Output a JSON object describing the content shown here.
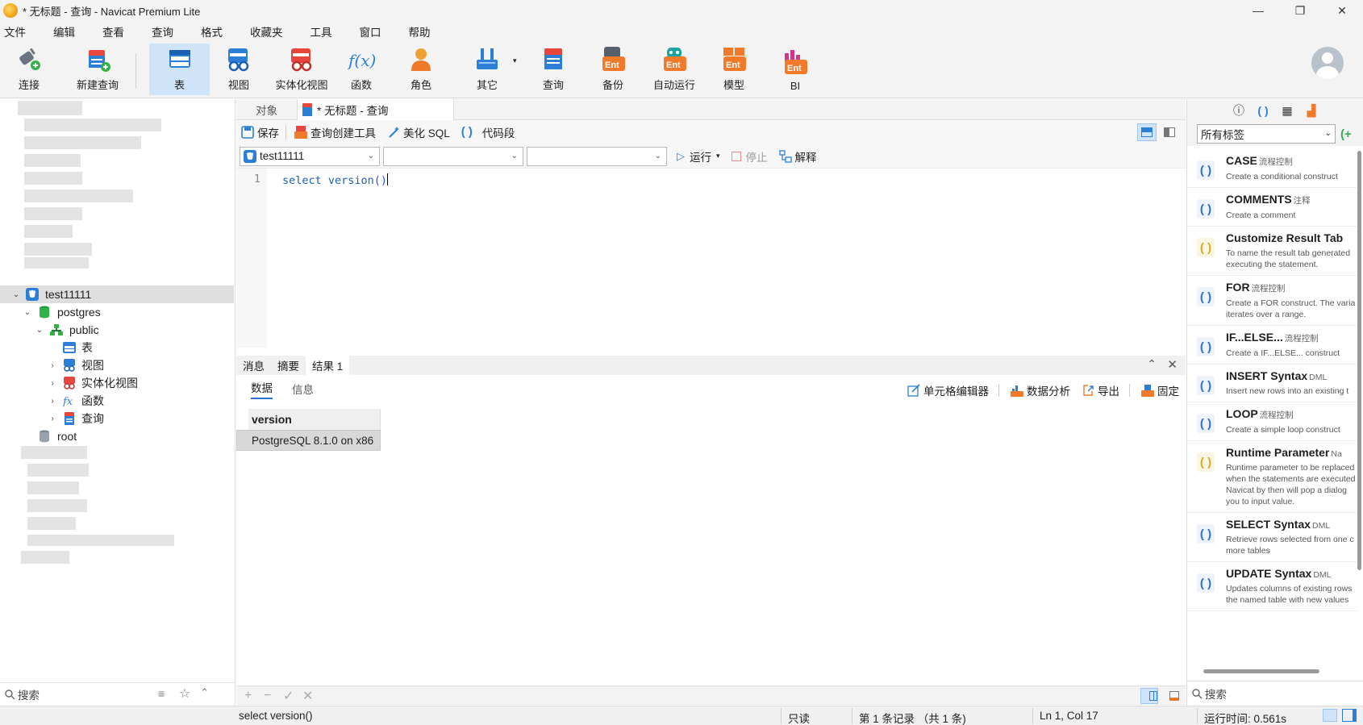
{
  "window": {
    "title": "* 无标题 - 查询 - Navicat Premium Lite",
    "controls": [
      "—",
      "❐",
      "✕"
    ]
  },
  "menu": [
    "文件",
    "编辑",
    "查看",
    "查询",
    "格式",
    "收藏夹",
    "工具",
    "窗口",
    "帮助"
  ],
  "toolbar": {
    "connect": "连接",
    "new_query": "新建查询",
    "table": "表",
    "view": "视图",
    "materialized_view": "实体化视图",
    "function": "函数",
    "role": "角色",
    "other": "其它",
    "query": "查询",
    "backup": "备份",
    "automation": "自动运行",
    "model": "模型",
    "bi": "BI",
    "ent_badge": "Ent",
    "fx_glyph": "f(x)"
  },
  "tree": {
    "connection": "test11111",
    "database": "postgres",
    "schema": "public",
    "children": [
      "表",
      "视图",
      "实体化视图",
      "函数",
      "查询"
    ],
    "other_connection": "root",
    "fx_glyph": "fx"
  },
  "sidebar_search": {
    "placeholder": "搜索"
  },
  "tabs": {
    "objects": "对象",
    "query_tab": "* 无标题 - 查询"
  },
  "editor_toolbar": {
    "save": "保存",
    "query_builder": "查询创建工具",
    "beautify": "美化 SQL",
    "snippet": "代码段"
  },
  "query_bar": {
    "connection": "test11111",
    "database": "",
    "schema": "",
    "run": "运行",
    "stop": "停止",
    "explain": "解释"
  },
  "editor": {
    "line_number": "1",
    "code": "select version()"
  },
  "result_tabs": [
    "消息",
    "摘要",
    "结果 1"
  ],
  "result_subtabs": [
    "数据",
    "信息"
  ],
  "result_actions": {
    "cell_editor": "单元格编辑器",
    "data_analysis": "数据分析",
    "export": "导出",
    "pin": "固定"
  },
  "result_grid": {
    "columns": [
      "version"
    ],
    "rows": [
      [
        "PostgreSQL 8.1.0 on x86"
      ]
    ]
  },
  "right_panel": {
    "filter": "所有标签",
    "snippets": [
      {
        "name": "CASE",
        "tag": "流程控制",
        "desc": "Create a conditional construct",
        "icon": "blue"
      },
      {
        "name": "COMMENTS",
        "tag": "注释",
        "desc": "Create a comment",
        "icon": "blue"
      },
      {
        "name": "Customize Result Tab",
        "tag": "",
        "desc": "To name the result tab generated executing the statement.",
        "icon": "yellow"
      },
      {
        "name": "FOR",
        "tag": "流程控制",
        "desc": "Create a FOR construct. The varia iterates over a range.",
        "icon": "blue"
      },
      {
        "name": "IF...ELSE...",
        "tag": "流程控制",
        "desc": "Create a IF...ELSE... construct",
        "icon": "blue"
      },
      {
        "name": "INSERT Syntax",
        "tag": "DML",
        "desc": "Insert new rows into an existing t",
        "icon": "blue"
      },
      {
        "name": "LOOP",
        "tag": "流程控制",
        "desc": "Create a simple loop construct",
        "icon": "blue"
      },
      {
        "name": "Runtime Parameter",
        "tag": "Na",
        "desc": "Runtime parameter to be replaced when the statements are executed Navicat by then will pop a dialog you to input value.",
        "icon": "yellow"
      },
      {
        "name": "SELECT Syntax",
        "tag": "DML",
        "desc": "Retrieve rows selected from one c more tables",
        "icon": "blue"
      },
      {
        "name": "UPDATE Syntax",
        "tag": "DML",
        "desc": "Updates columns of existing rows the named table with new values",
        "icon": "blue"
      }
    ],
    "search_placeholder": "搜索"
  },
  "statusbar": {
    "sql": "select version()",
    "readonly": "只读",
    "records": "第 1 条记录 （共 1 条)",
    "position": "Ln 1, Col 17",
    "elapsed": "运行时间: 0.561s"
  },
  "colors": {
    "accent": "#2b6fd6",
    "toolbar_active": "#cfe4f8",
    "ent_orange": "#f07a2a"
  }
}
